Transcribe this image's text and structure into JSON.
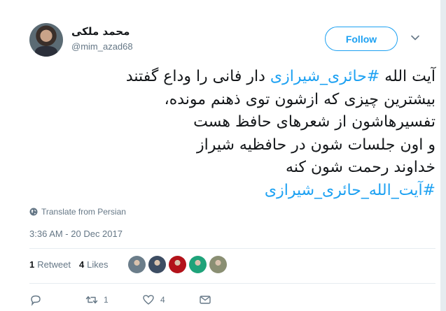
{
  "user": {
    "display_name": "محمد ملکی",
    "handle": "@mim_azad68"
  },
  "follow_button": {
    "label": "Follow"
  },
  "tweet": {
    "lines": [
      {
        "before": "آیت الله ",
        "hashtag": "#حائری_شیرازی",
        "after": " دار فانی را وداع گفتند"
      },
      {
        "text": "بیشترین چیزی که ازشون توی ذهنم مونده،"
      },
      {
        "text": "تفسیرهاشون از شعرهای حافظ هست"
      },
      {
        "text": "و اون جلسات شون در حافظیه شیراز"
      },
      {
        "text": "خداوند رحمت شون کنه"
      },
      {
        "hashtag": "#آیت_الله_حائری_شیرازی"
      }
    ]
  },
  "translate": {
    "label": "Translate from Persian",
    "icon": "globe-icon"
  },
  "timestamp": "3:36 AM - 20 Dec 2017",
  "stats": {
    "retweets_count": "1",
    "retweets_label": "Retweet",
    "likes_count": "4",
    "likes_label": "Likes"
  },
  "likers": [
    {
      "name": "liker-1",
      "color": "#6b7d8a"
    },
    {
      "name": "liker-2",
      "color": "#3d4d63"
    },
    {
      "name": "liker-3",
      "color": "#b3121a"
    },
    {
      "name": "liker-4",
      "color": "#1fa37a"
    },
    {
      "name": "liker-5",
      "color": "#8a8f73"
    }
  ],
  "actions": {
    "reply": {
      "icon": "reply-icon",
      "count": ""
    },
    "retweet": {
      "icon": "retweet-icon",
      "count": "1"
    },
    "like": {
      "icon": "heart-icon",
      "count": "4"
    },
    "message": {
      "icon": "direct-message-icon",
      "count": ""
    }
  },
  "colors": {
    "accent": "#1da1f2",
    "text": "#14171a",
    "muted": "#657786",
    "divider": "#e6ecf0"
  }
}
